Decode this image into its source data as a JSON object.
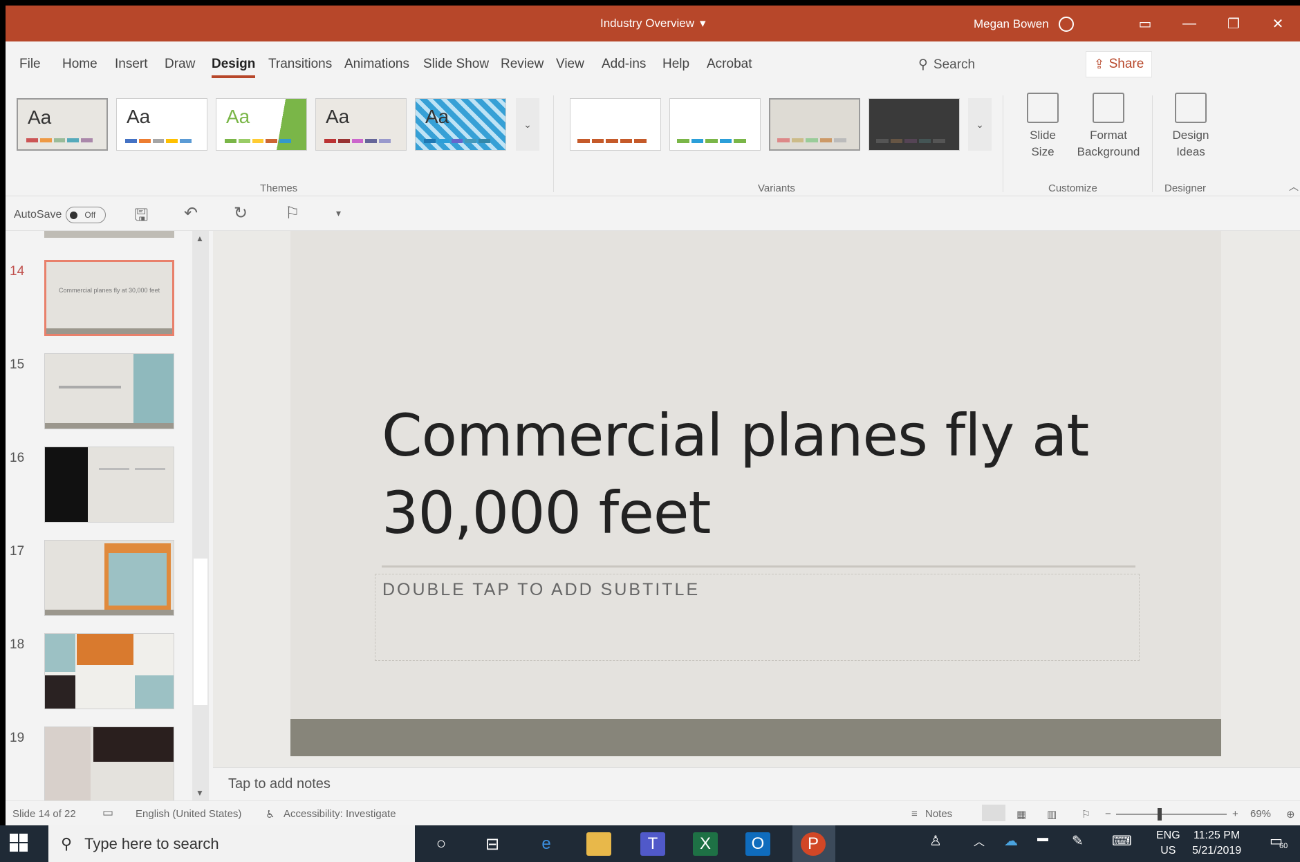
{
  "titlebar": {
    "doc_title": "Industry Overview",
    "user": "Megan Bowen",
    "colors": {
      "accent": "#b7472a"
    }
  },
  "tabs": {
    "file": "File",
    "home": "Home",
    "insert": "Insert",
    "draw": "Draw",
    "design": "Design",
    "transitions": "Transitions",
    "animations": "Animations",
    "slideshow": "Slide Show",
    "review": "Review",
    "view": "View",
    "addins": "Add-ins",
    "help": "Help",
    "acrobat": "Acrobat",
    "search": "Search",
    "share": "Share"
  },
  "ribbon": {
    "themes_label": "Themes",
    "variants_label": "Variants",
    "customize_label": "Customize",
    "designer_label": "Designer",
    "theme_aa": "Aa",
    "slide_size": "Slide Size",
    "format_background": "Format Background",
    "design_ideas": "Design Ideas"
  },
  "qat": {
    "autosave": "AutoSave",
    "toggle": "Off"
  },
  "thumbnails": {
    "numbers": [
      "14",
      "15",
      "16",
      "17",
      "18",
      "19"
    ],
    "selected_text": "Commercial planes fly at 30,000 feet"
  },
  "slide": {
    "title_line1": "Commercial planes fly at",
    "title_line2": "30,000 feet",
    "subtitle_placeholder": "DOUBLE TAP TO ADD SUBTITLE"
  },
  "notes": {
    "placeholder": "Tap to add notes"
  },
  "status": {
    "slide_count": "Slide 14 of 22",
    "language": "English (United States)",
    "accessibility": "Accessibility: Investigate",
    "notes": "Notes",
    "zoom": "69%"
  },
  "taskbar": {
    "search_placeholder": "Type here to search",
    "lang1": "ENG",
    "lang2": "US",
    "time": "11:25 PM",
    "date": "5/21/2019",
    "notif_count": "60"
  }
}
